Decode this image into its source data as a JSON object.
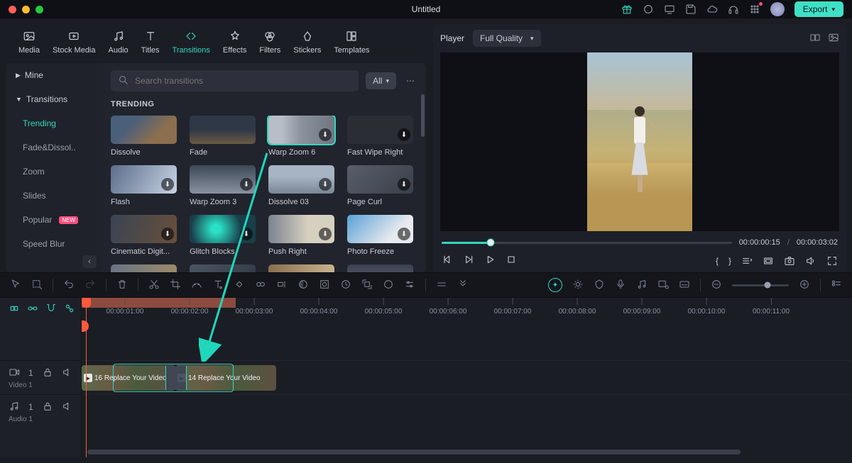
{
  "title": "Untitled",
  "export_label": "Export",
  "tabs": [
    {
      "label": "Media"
    },
    {
      "label": "Stock Media"
    },
    {
      "label": "Audio"
    },
    {
      "label": "Titles"
    },
    {
      "label": "Transitions"
    },
    {
      "label": "Effects"
    },
    {
      "label": "Filters"
    },
    {
      "label": "Stickers"
    },
    {
      "label": "Templates"
    }
  ],
  "active_tab": 4,
  "sidebar": {
    "mine": "Mine",
    "transitions": "Transitions",
    "items": [
      {
        "label": "Trending",
        "active": true
      },
      {
        "label": "Fade&Dissol.."
      },
      {
        "label": "Zoom"
      },
      {
        "label": "Slides"
      },
      {
        "label": "Popular",
        "badge": "NEW"
      },
      {
        "label": "Speed Blur"
      }
    ]
  },
  "search": {
    "placeholder": "Search transitions"
  },
  "filter_all": "All",
  "section_header": "TRENDING",
  "transitions_grid": [
    {
      "label": "Dissolve"
    },
    {
      "label": "Fade"
    },
    {
      "label": "Warp Zoom 6",
      "selected": true,
      "dl": true
    },
    {
      "label": "Fast Wipe Right",
      "dl": true
    },
    {
      "label": "Flash",
      "dl": true
    },
    {
      "label": "Warp Zoom 3",
      "dl": true
    },
    {
      "label": "Dissolve 03",
      "dl": true
    },
    {
      "label": "Page Curl",
      "dl": true
    },
    {
      "label": "Cinematic Digit...",
      "dl": true
    },
    {
      "label": "Glitch Blocks",
      "dl": true
    },
    {
      "label": "Push Right",
      "dl": true
    },
    {
      "label": "Photo Freeze",
      "dl": true
    },
    {
      "label": ""
    },
    {
      "label": ""
    },
    {
      "label": ""
    },
    {
      "label": ""
    }
  ],
  "player": {
    "title": "Player",
    "quality": "Full Quality",
    "current": "00:00:00:15",
    "total": "00:00:03:02"
  },
  "ruler_ticks": [
    "00:00:01:00",
    "00:00:02:00",
    "00:00:03:00",
    "00:00:04:00",
    "00:00:05:00",
    "00:00:06:00",
    "00:00:07:00",
    "00:00:08:00",
    "00:00:09:00",
    "00:00:10:00",
    "00:00:11:00"
  ],
  "tracks": {
    "video1": {
      "label": "Video 1"
    },
    "audio1": {
      "label": "Audio 1"
    }
  },
  "clips": {
    "a": "16 Replace Your Video",
    "b": "14 Replace Your Video"
  },
  "playhead_pct": 1.5,
  "ruler_fill_pct": 20
}
